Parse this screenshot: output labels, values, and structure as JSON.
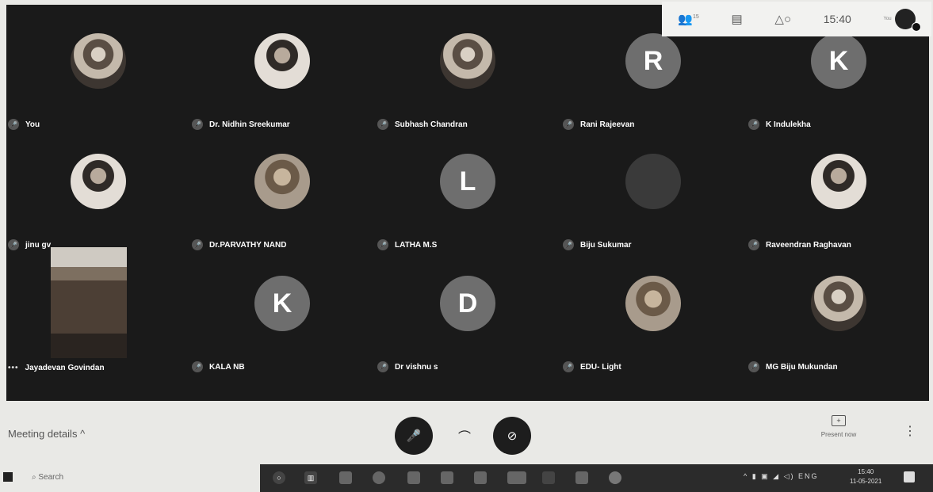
{
  "topbar": {
    "people_icon": "people-icon",
    "people_count": "15",
    "chat_icon": "chat-icon",
    "activities_icon": "activities-icon",
    "time": "15:40",
    "you_label": "You"
  },
  "participants": [
    {
      "name": "You",
      "avatar": "photo"
    },
    {
      "name": "Dr. Nidhin Sreekumar",
      "avatar": "photo2"
    },
    {
      "name": "Subhash Chandran",
      "avatar": "photo"
    },
    {
      "name": "Rani Rajeevan",
      "avatar": "letter",
      "initial": "R"
    },
    {
      "name": "K Indulekha",
      "avatar": "letter",
      "initial": "K"
    },
    {
      "name": "jinu gv",
      "avatar": "photo2"
    },
    {
      "name": "Dr.PARVATHY NAND",
      "avatar": "photo3"
    },
    {
      "name": "LATHA M.S",
      "avatar": "letter",
      "initial": "L"
    },
    {
      "name": "Biju Sukumar",
      "avatar": "dark"
    },
    {
      "name": "Raveendran Raghavan",
      "avatar": "photo2"
    },
    {
      "name": "Jayadevan Govindan",
      "avatar": "camera"
    },
    {
      "name": "KALA NB",
      "avatar": "letter",
      "initial": "K"
    },
    {
      "name": "Dr vishnu s",
      "avatar": "letter",
      "initial": "D"
    },
    {
      "name": "EDU- Light",
      "avatar": "photo3"
    },
    {
      "name": "MG Biju Mukundan",
      "avatar": "photo"
    }
  ],
  "controls": {
    "meeting_details": "Meeting details",
    "present_now": "Present now"
  },
  "taskbar": {
    "search": "Search",
    "lang": "ENG",
    "time": "15:40",
    "date": "11-05-2021"
  }
}
